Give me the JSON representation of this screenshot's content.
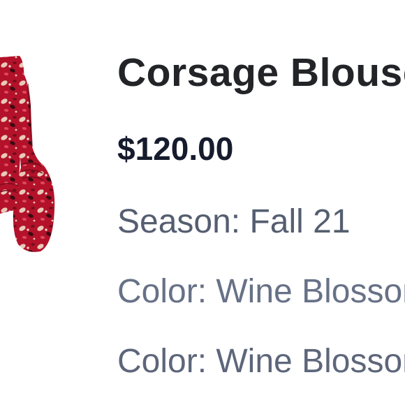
{
  "product": {
    "title": "Corsage Blouse",
    "price": "$120.00",
    "season": "Season: Fall 21",
    "color_primary": "Color: Wine Blossom",
    "color_secondary": "Color: Wine Blossom",
    "image_icon": "blouse-photo"
  },
  "colors": {
    "title": "#222428",
    "price": "#161b2d",
    "attribute": "#5a6376",
    "fabric": "#b3122a"
  }
}
